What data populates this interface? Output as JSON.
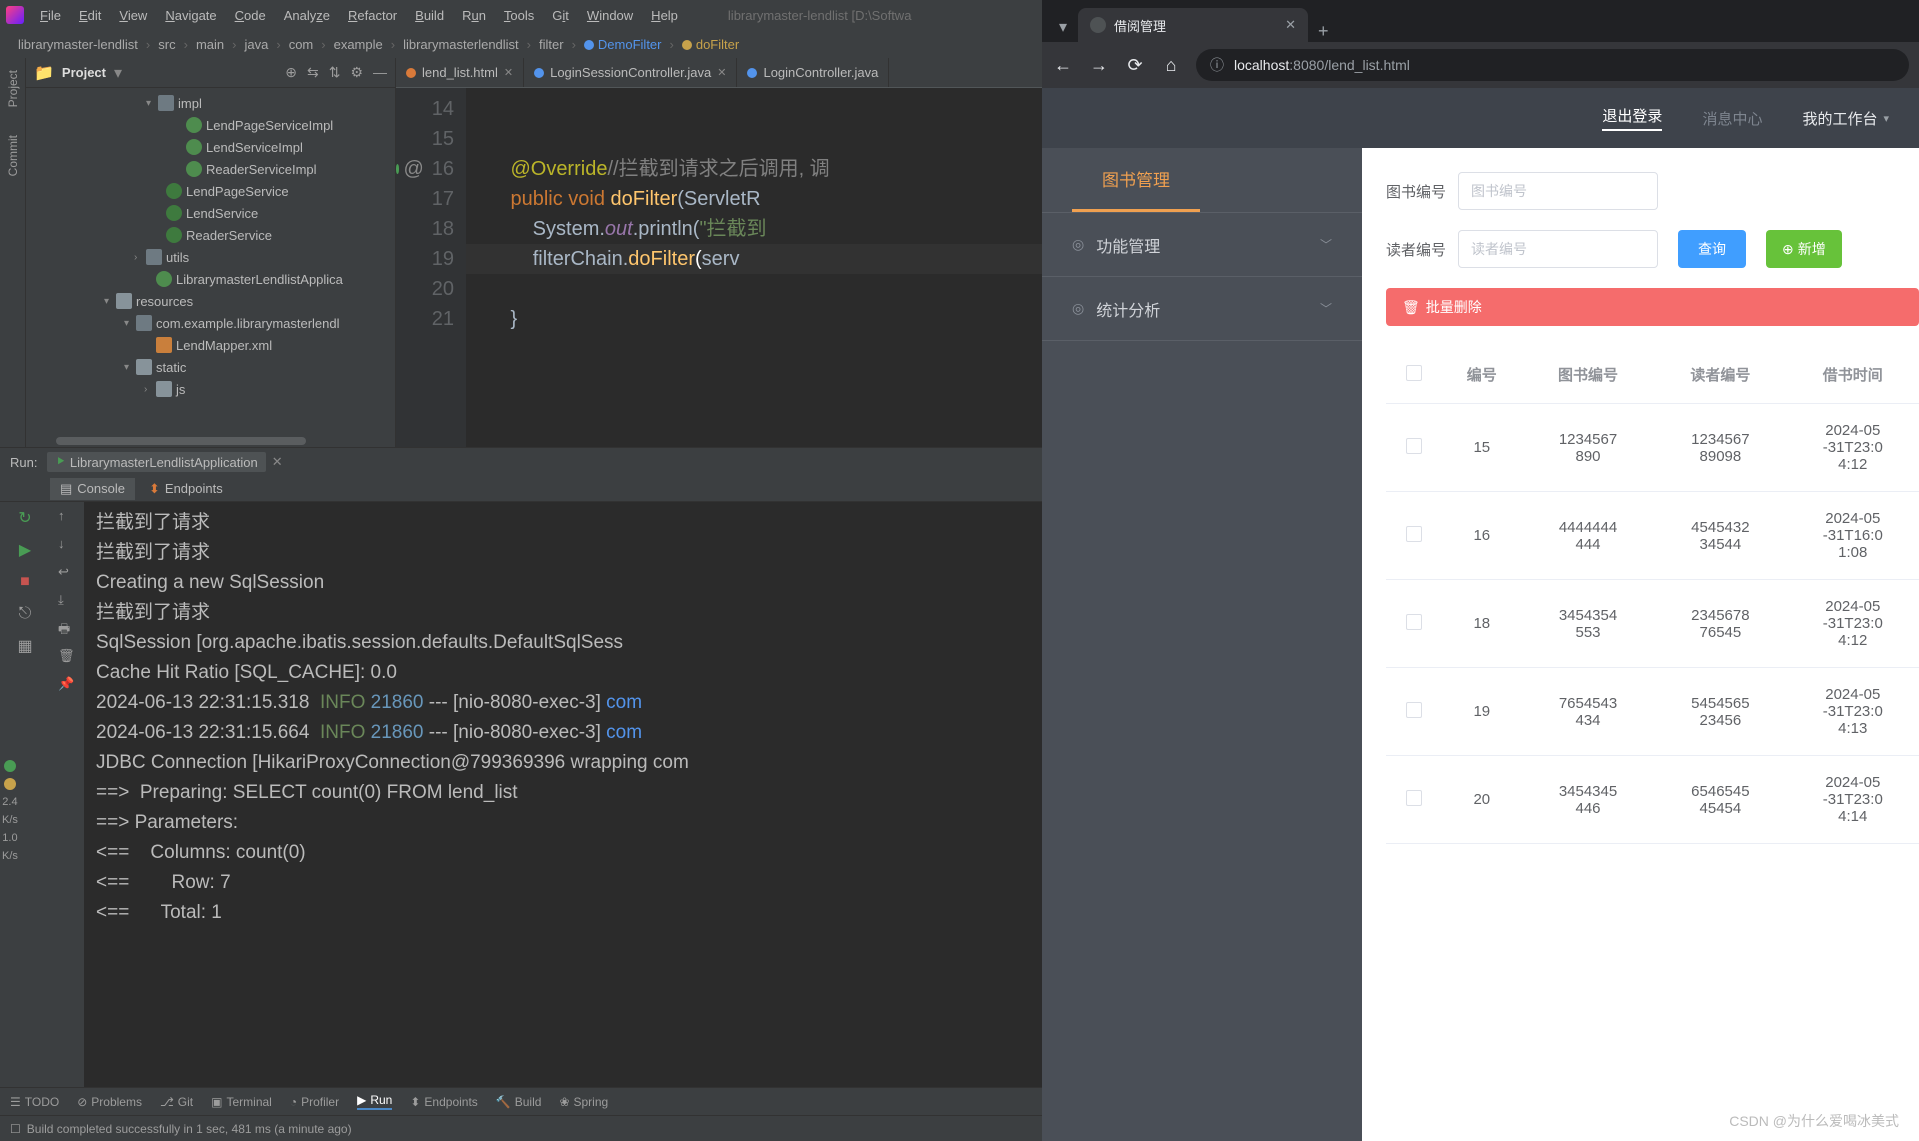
{
  "ide": {
    "window_title": "librarymaster-lendlist [D:\\Softwa",
    "menu": [
      "File",
      "Edit",
      "View",
      "Navigate",
      "Code",
      "Analyze",
      "Refactor",
      "Build",
      "Run",
      "Tools",
      "Git",
      "Window",
      "Help"
    ],
    "breadcrumbs": [
      "librarymaster-lendlist",
      "src",
      "main",
      "java",
      "com",
      "example",
      "librarymasterlendlist",
      "filter",
      "DemoFilter",
      "doFilter"
    ],
    "project_title": "Project",
    "tree": {
      "impl": "impl",
      "lend_page_service_impl": "LendPageServiceImpl",
      "lend_service_impl": "LendServiceImpl",
      "reader_service_impl": "ReaderServiceImpl",
      "lend_page_service": "LendPageService",
      "lend_service": "LendService",
      "reader_service": "ReaderService",
      "utils": "utils",
      "app_class": "LibrarymasterLendlistApplica",
      "resources": "resources",
      "pkg_res": "com.example.librarymasterlendl",
      "mapper": "LendMapper.xml",
      "static": "static",
      "js": "js"
    },
    "editor_tabs": [
      {
        "name": "lend_list.html",
        "kind": "html"
      },
      {
        "name": "LoginSessionController.java",
        "kind": "java"
      },
      {
        "name": "LoginController.java",
        "kind": "java"
      }
    ],
    "gutter": [
      "14",
      "15",
      "16",
      "17",
      "18",
      "19",
      "20",
      "21"
    ],
    "code": {
      "l14": "",
      "l15_ann": "@Override",
      "l15_cm": "//拦截到请求之后调用, 调",
      "l16": "public void doFilter(ServletR",
      "l17_a": "System.",
      "l17_b": "out",
      "l17_c": ".println(",
      "l17_d": "\"拦截到",
      "l18_a": "filterChain.",
      "l18_b": "doFilter",
      "l18_c": "(serv",
      "l20": "}"
    },
    "run": {
      "label": "Run:",
      "config": "LibrarymasterLendlistApplication",
      "subtabs": [
        "Console",
        "Endpoints"
      ],
      "console_lines": [
        "拦截到了请求",
        "拦截到了请求",
        "Creating a new SqlSession",
        "拦截到了请求",
        "",
        "SqlSession [org.apache.ibatis.session.defaults.DefaultSqlSess",
        "Cache Hit Ratio [SQL_CACHE]: 0.0",
        {
          "ts": "2024-06-13 22:31:15.318",
          "lvl": "INFO",
          "pid": "21860",
          "rest": " --- [nio-8080-exec-3] ",
          "pkg": "com"
        },
        {
          "ts": "2024-06-13 22:31:15.664",
          "lvl": "INFO",
          "pid": "21860",
          "rest": " --- [nio-8080-exec-3] ",
          "pkg": "com"
        },
        "JDBC Connection [HikariProxyConnection@799369396 wrapping com",
        "==>  Preparing: SELECT count(0) FROM lend_list",
        "==> Parameters: ",
        "<==    Columns: count(0)",
        "<==        Row: 7",
        "<==      Total: 1"
      ]
    },
    "bottom_bar": [
      "TODO",
      "Problems",
      "Git",
      "Terminal",
      "Profiler",
      "Run",
      "Endpoints",
      "Build",
      "Spring"
    ],
    "status": "Build completed successfully in 1 sec, 481 ms (a minute ago)",
    "indicators": [
      "2.4",
      "K/s",
      "1.0",
      "K/s"
    ]
  },
  "browser": {
    "tab_title": "借阅管理",
    "url_host": "localhost",
    "url_port": ":8080",
    "url_path": "/lend_list.html",
    "topnav": {
      "logout": "退出登录",
      "msg": "消息中心",
      "work": "我的工作台"
    },
    "sidebar": {
      "title": "图书管理",
      "func": "功能管理",
      "stat": "统计分析"
    },
    "filters": {
      "book_label": "图书编号",
      "book_ph": "图书编号",
      "reader_label": "读者编号",
      "reader_ph": "读者编号",
      "query": "查询",
      "add": "新增",
      "batch_del": "批量删除"
    },
    "table": {
      "headers": [
        "",
        "编号",
        "图书编号",
        "读者编号",
        "借书时间"
      ],
      "rows": [
        {
          "id": "15",
          "book": "1234567890",
          "reader": "123456789098",
          "time": "2024-05-31T23:04:12"
        },
        {
          "id": "16",
          "book": "4444444444",
          "reader": "454543234544",
          "time": "2024-05-31T16:01:08"
        },
        {
          "id": "18",
          "book": "3454354553",
          "reader": "234567876545",
          "time": "2024-05-31T23:04:12"
        },
        {
          "id": "19",
          "book": "7654543434",
          "reader": "545456523456",
          "time": "2024-05-31T23:04:13"
        },
        {
          "id": "20",
          "book": "3454345446",
          "reader": "654654545454",
          "time": "2024-05-31T23:04:14"
        }
      ]
    }
  },
  "watermark": "CSDN @为什么爱喝冰美式"
}
